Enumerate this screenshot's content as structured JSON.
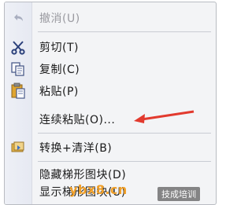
{
  "menu": {
    "items": [
      {
        "label": "撤消(U)",
        "icon": "undo-icon",
        "enabled": false
      },
      {
        "label": "剪切(T)",
        "icon": "scissors-icon",
        "enabled": true
      },
      {
        "label": "复制(C)",
        "icon": "copy-icon",
        "enabled": true
      },
      {
        "label": "粘贴(P)",
        "icon": "paste-icon",
        "enabled": true
      },
      {
        "label": "连续粘贴(O)...",
        "icon": null,
        "enabled": true
      },
      {
        "label": "转换+清洋(B)",
        "icon": "convert-icon",
        "enabled": true
      },
      {
        "label": "隐藏梯形图块(D)",
        "icon": null,
        "enabled": true
      },
      {
        "label": "显示梯形图块(U)",
        "icon": null,
        "enabled": true
      }
    ]
  },
  "annotation": {
    "color": "#e23a2e"
  },
  "watermarks": {
    "left": "ybx8.cn",
    "right": "技成培训"
  }
}
